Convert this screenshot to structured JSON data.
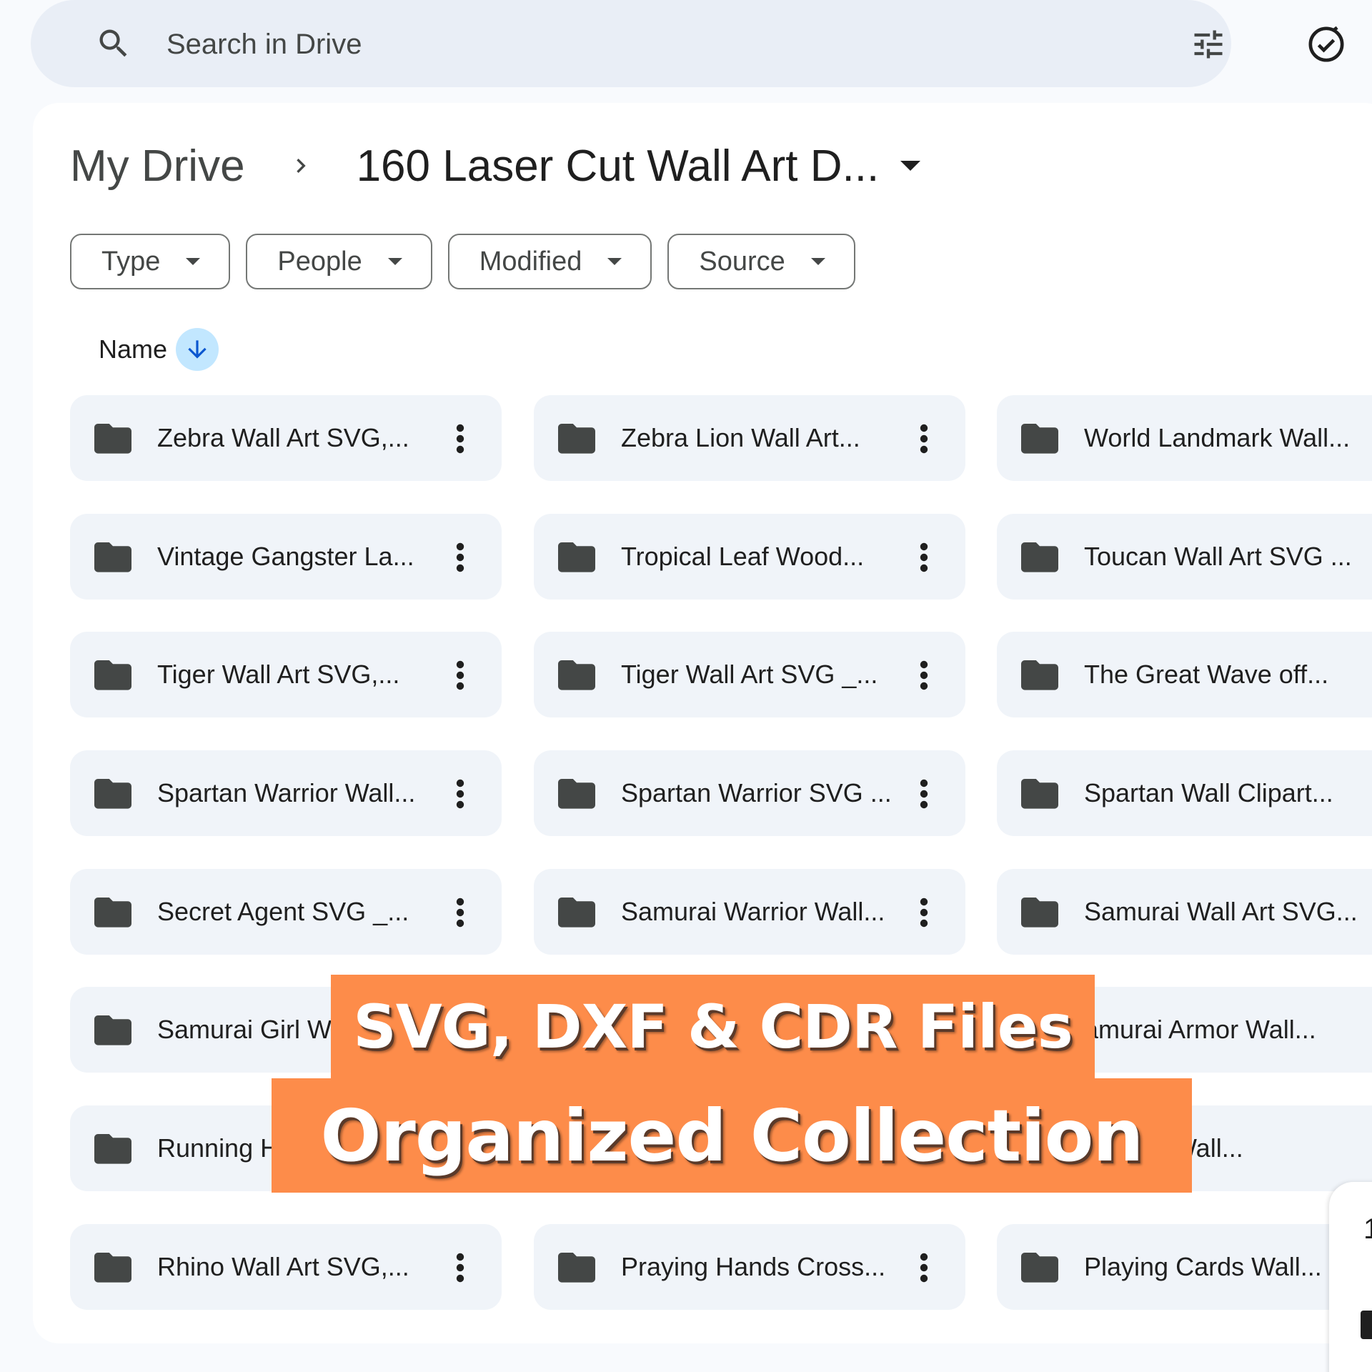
{
  "search": {
    "placeholder": "Search in Drive"
  },
  "breadcrumb": {
    "root": "My Drive",
    "current": "160 Laser Cut Wall Art D..."
  },
  "filters": [
    {
      "label": "Type"
    },
    {
      "label": "People"
    },
    {
      "label": "Modified"
    },
    {
      "label": "Source"
    }
  ],
  "sort": {
    "label": "Name",
    "direction": "descending"
  },
  "folders": [
    {
      "name": "Zebra Wall Art SVG,..."
    },
    {
      "name": "Zebra Lion Wall Art..."
    },
    {
      "name": "World Landmark Wall..."
    },
    {
      "name": "Vintage Gangster La..."
    },
    {
      "name": "Tropical Leaf Wood..."
    },
    {
      "name": "Toucan Wall Art SVG ..."
    },
    {
      "name": "Tiger Wall Art SVG,..."
    },
    {
      "name": "Tiger Wall Art SVG _..."
    },
    {
      "name": "The Great Wave off..."
    },
    {
      "name": "Spartan Warrior Wall..."
    },
    {
      "name": "Spartan Warrior SVG ..."
    },
    {
      "name": "Spartan Wall Clipart..."
    },
    {
      "name": "Secret Agent SVG _..."
    },
    {
      "name": "Samurai Warrior Wall..."
    },
    {
      "name": "Samurai Wall Art SVG..."
    },
    {
      "name": "Samurai Girl W"
    },
    {
      "name": ""
    },
    {
      "name": "amurai Armor Wall..."
    },
    {
      "name": "Running H"
    },
    {
      "name": ""
    },
    {
      "name": "Horses Wall..."
    },
    {
      "name": "Rhino Wall Art SVG,..."
    },
    {
      "name": "Praying Hands Cross..."
    },
    {
      "name": "Playing Cards Wall..."
    }
  ],
  "banner": {
    "line1": "SVG, DXF & CDR Files",
    "line2": "Organized Collection",
    "color": "#fd8c4a"
  },
  "side_panel": {
    "digit": "1"
  },
  "colors": {
    "background": "#f8fafd",
    "search_bg": "#e9eef6",
    "card_bg": "#f0f4f9",
    "sort_chip": "#c2e7ff",
    "sort_arrow": "#0b57d0"
  }
}
